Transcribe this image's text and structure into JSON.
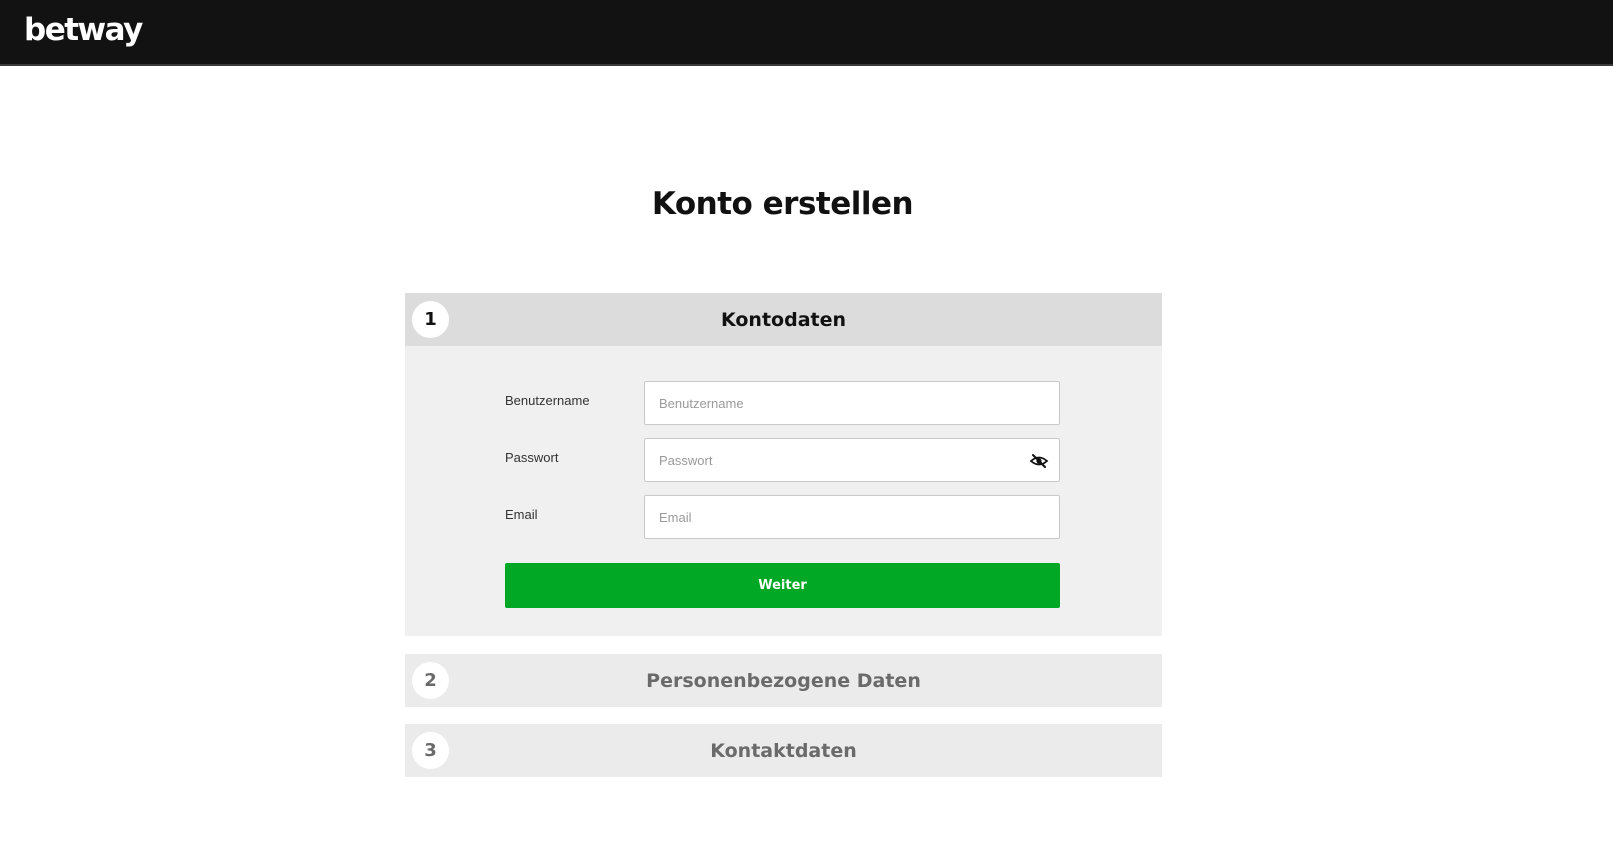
{
  "header": {
    "logo_text": "betway",
    "background": "#121212"
  },
  "page": {
    "title": "Konto erstellen"
  },
  "steps": [
    {
      "number": "1",
      "title": "Kontodaten",
      "state": "active"
    },
    {
      "number": "2",
      "title": "Personenbezogene Daten",
      "state": "collapsed"
    },
    {
      "number": "3",
      "title": "Kontaktdaten",
      "state": "collapsed"
    }
  ],
  "form": {
    "username": {
      "label": "Benutzername",
      "placeholder": "Benutzername",
      "value": ""
    },
    "password": {
      "label": "Passwort",
      "placeholder": "Passwort",
      "value": "",
      "toggle_icon": "eye-slash-icon"
    },
    "email": {
      "label": "Email",
      "placeholder": "Email",
      "value": ""
    },
    "submit_label": "Weiter"
  },
  "colors": {
    "accent_green": "#00a826",
    "active_header": "#dcdcdc",
    "panel_background": "#f0f0f0",
    "inactive_text": "#6a6a6a"
  }
}
